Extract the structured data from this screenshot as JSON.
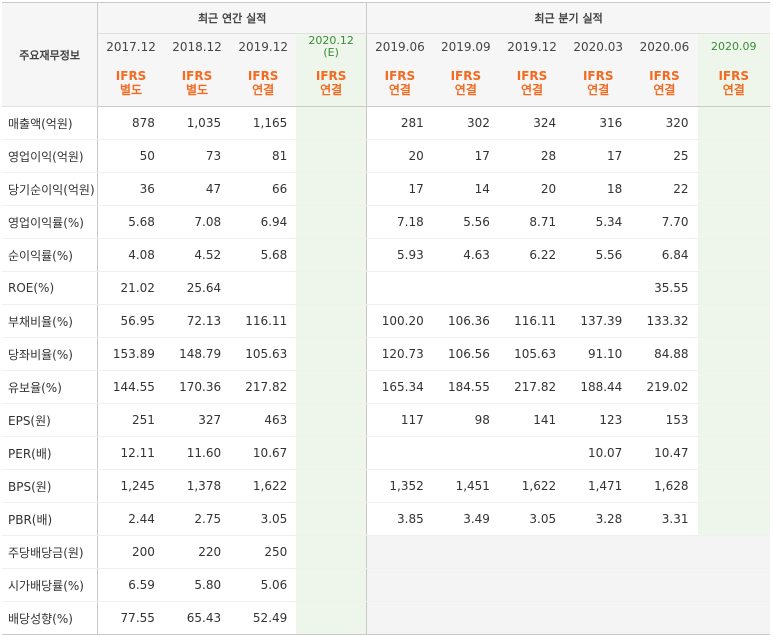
{
  "header": {
    "row_label": "주요재무정보",
    "annual_group": "최근 연간 실적",
    "quarter_group": "최근 분기 실적",
    "estimate_mark": "(E)"
  },
  "periods": [
    "2017.12",
    "2018.12",
    "2019.12",
    "2020.12",
    "2019.06",
    "2019.09",
    "2019.12",
    "2020.03",
    "2020.06",
    "2020.09"
  ],
  "estimate_columns": [
    3,
    9
  ],
  "ifrs": [
    {
      "line1": "IFRS",
      "line2": "별도"
    },
    {
      "line1": "IFRS",
      "line2": "별도"
    },
    {
      "line1": "IFRS",
      "line2": "연결"
    },
    {
      "line1": "IFRS",
      "line2": "연결"
    },
    {
      "line1": "IFRS",
      "line2": "연결"
    },
    {
      "line1": "IFRS",
      "line2": "연결"
    },
    {
      "line1": "IFRS",
      "line2": "연결"
    },
    {
      "line1": "IFRS",
      "line2": "연결"
    },
    {
      "line1": "IFRS",
      "line2": "연결"
    },
    {
      "line1": "IFRS",
      "line2": "연결"
    }
  ],
  "rows": [
    {
      "label": "매출액(억원)",
      "values": [
        "878",
        "1,035",
        "1,165",
        "",
        "281",
        "302",
        "324",
        "316",
        "320",
        ""
      ]
    },
    {
      "label": "영업이익(억원)",
      "values": [
        "50",
        "73",
        "81",
        "",
        "20",
        "17",
        "28",
        "17",
        "25",
        ""
      ]
    },
    {
      "label": "당기순이익(억원)",
      "values": [
        "36",
        "47",
        "66",
        "",
        "17",
        "14",
        "20",
        "18",
        "22",
        ""
      ]
    },
    {
      "label": "영업이익률(%)",
      "values": [
        "5.68",
        "7.08",
        "6.94",
        "",
        "7.18",
        "5.56",
        "8.71",
        "5.34",
        "7.70",
        ""
      ]
    },
    {
      "label": "순이익률(%)",
      "values": [
        "4.08",
        "4.52",
        "5.68",
        "",
        "5.93",
        "4.63",
        "6.22",
        "5.56",
        "6.84",
        ""
      ]
    },
    {
      "label": "ROE(%)",
      "values": [
        "21.02",
        "25.64",
        "",
        "",
        "",
        "",
        "",
        "",
        "35.55",
        ""
      ]
    },
    {
      "label": "부채비율(%)",
      "values": [
        "56.95",
        "72.13",
        "116.11",
        "",
        "100.20",
        "106.36",
        "116.11",
        "137.39",
        "133.32",
        ""
      ]
    },
    {
      "label": "당좌비율(%)",
      "values": [
        "153.89",
        "148.79",
        "105.63",
        "",
        "120.73",
        "106.56",
        "105.63",
        "91.10",
        "84.88",
        ""
      ]
    },
    {
      "label": "유보율(%)",
      "values": [
        "144.55",
        "170.36",
        "217.82",
        "",
        "165.34",
        "184.55",
        "217.82",
        "188.44",
        "219.02",
        ""
      ]
    },
    {
      "label": "EPS(원)",
      "values": [
        "251",
        "327",
        "463",
        "",
        "117",
        "98",
        "141",
        "123",
        "153",
        ""
      ]
    },
    {
      "label": "PER(배)",
      "values": [
        "12.11",
        "11.60",
        "10.67",
        "",
        "",
        "",
        "",
        "10.07",
        "10.47",
        ""
      ]
    },
    {
      "label": "BPS(원)",
      "values": [
        "1,245",
        "1,378",
        "1,622",
        "",
        "1,352",
        "1,451",
        "1,622",
        "1,471",
        "1,628",
        ""
      ]
    },
    {
      "label": "PBR(배)",
      "values": [
        "2.44",
        "2.75",
        "3.05",
        "",
        "3.85",
        "3.49",
        "3.05",
        "3.28",
        "3.31",
        ""
      ]
    },
    {
      "label": "주당배당금(원)",
      "values": [
        "200",
        "220",
        "250",
        "",
        "",
        "",
        "",
        "",
        "",
        ""
      ],
      "quarter_blank": true
    },
    {
      "label": "시가배당률(%)",
      "values": [
        "6.59",
        "5.80",
        "5.06",
        "",
        "",
        "",
        "",
        "",
        "",
        ""
      ],
      "quarter_blank": true
    },
    {
      "label": "배당성향(%)",
      "values": [
        "77.55",
        "65.43",
        "52.49",
        "",
        "",
        "",
        "",
        "",
        "",
        ""
      ],
      "quarter_blank": true
    }
  ],
  "group_starts": [
    3,
    6,
    9,
    13
  ],
  "colors": {
    "ifrs_text": "#f26b21",
    "estimate_bg": "#eef6ec",
    "estimate_text": "#3a8a3a",
    "header_bg": "#f6f6f6",
    "blank_bg": "#f4f4f4"
  }
}
